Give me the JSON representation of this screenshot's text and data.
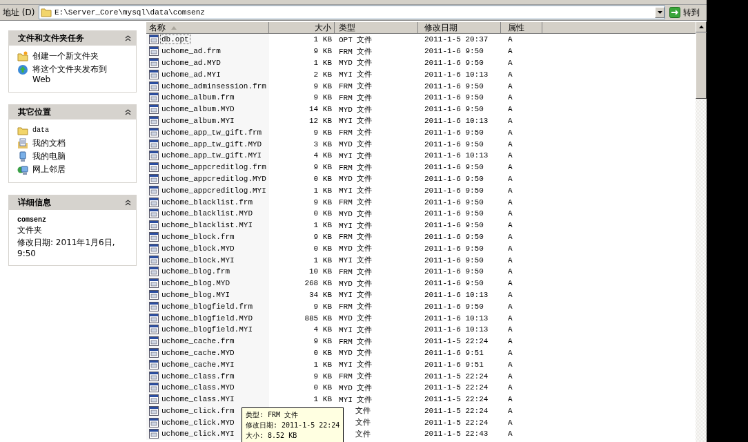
{
  "address_bar": {
    "label": "地址 (D)",
    "path": "E:\\Server_Core\\mysql\\data\\comsenz",
    "go_button": "转到"
  },
  "task_panels": [
    {
      "title": "文件和文件夹任务",
      "items": [
        {
          "label": "创建一个新文件夹",
          "kind": "new-folder"
        },
        {
          "label": "将这个文件夹发布到 Web",
          "kind": "publish-web"
        }
      ]
    },
    {
      "title": "其它位置",
      "items": [
        {
          "label": "data",
          "kind": "folder"
        },
        {
          "label": "我的文档",
          "kind": "documents"
        },
        {
          "label": "我的电脑",
          "kind": "computer"
        },
        {
          "label": "网上邻居",
          "kind": "network"
        }
      ]
    }
  ],
  "details_panel": {
    "title": "详细信息",
    "name": "comsenz",
    "type": "文件夹",
    "modified": "修改日期: 2011年1月6日, 9:50"
  },
  "columns": [
    {
      "label": "名称",
      "sorted": true
    },
    {
      "label": "大小",
      "sorted": false
    },
    {
      "label": "类型",
      "sorted": false
    },
    {
      "label": "修改日期",
      "sorted": false
    },
    {
      "label": "属性",
      "sorted": false
    }
  ],
  "rows": [
    {
      "name": "db.opt",
      "size": "1 KB",
      "type": "OPT 文件",
      "modified": "2011-1-5 20:37",
      "attr": "A",
      "focused": true
    },
    {
      "name": "uchome_ad.frm",
      "size": "9 KB",
      "type": "FRM 文件",
      "modified": "2011-1-6 9:50",
      "attr": "A",
      "focused": false
    },
    {
      "name": "uchome_ad.MYD",
      "size": "1 KB",
      "type": "MYD 文件",
      "modified": "2011-1-6 9:50",
      "attr": "A",
      "focused": false
    },
    {
      "name": "uchome_ad.MYI",
      "size": "2 KB",
      "type": "MYI 文件",
      "modified": "2011-1-6 10:13",
      "attr": "A",
      "focused": false
    },
    {
      "name": "uchome_adminsession.frm",
      "size": "9 KB",
      "type": "FRM 文件",
      "modified": "2011-1-6 9:50",
      "attr": "A",
      "focused": false
    },
    {
      "name": "uchome_album.frm",
      "size": "9 KB",
      "type": "FRM 文件",
      "modified": "2011-1-6 9:50",
      "attr": "A",
      "focused": false
    },
    {
      "name": "uchome_album.MYD",
      "size": "14 KB",
      "type": "MYD 文件",
      "modified": "2011-1-6 9:50",
      "attr": "A",
      "focused": false
    },
    {
      "name": "uchome_album.MYI",
      "size": "12 KB",
      "type": "MYI 文件",
      "modified": "2011-1-6 10:13",
      "attr": "A",
      "focused": false
    },
    {
      "name": "uchome_app_tw_gift.frm",
      "size": "9 KB",
      "type": "FRM 文件",
      "modified": "2011-1-6 9:50",
      "attr": "A",
      "focused": false
    },
    {
      "name": "uchome_app_tw_gift.MYD",
      "size": "3 KB",
      "type": "MYD 文件",
      "modified": "2011-1-6 9:50",
      "attr": "A",
      "focused": false
    },
    {
      "name": "uchome_app_tw_gift.MYI",
      "size": "4 KB",
      "type": "MYI 文件",
      "modified": "2011-1-6 10:13",
      "attr": "A",
      "focused": false
    },
    {
      "name": "uchome_appcreditlog.frm",
      "size": "9 KB",
      "type": "FRM 文件",
      "modified": "2011-1-6 9:50",
      "attr": "A",
      "focused": false
    },
    {
      "name": "uchome_appcreditlog.MYD",
      "size": "0 KB",
      "type": "MYD 文件",
      "modified": "2011-1-6 9:50",
      "attr": "A",
      "focused": false
    },
    {
      "name": "uchome_appcreditlog.MYI",
      "size": "1 KB",
      "type": "MYI 文件",
      "modified": "2011-1-6 9:50",
      "attr": "A",
      "focused": false
    },
    {
      "name": "uchome_blacklist.frm",
      "size": "9 KB",
      "type": "FRM 文件",
      "modified": "2011-1-6 9:50",
      "attr": "A",
      "focused": false
    },
    {
      "name": "uchome_blacklist.MYD",
      "size": "0 KB",
      "type": "MYD 文件",
      "modified": "2011-1-6 9:50",
      "attr": "A",
      "focused": false
    },
    {
      "name": "uchome_blacklist.MYI",
      "size": "1 KB",
      "type": "MYI 文件",
      "modified": "2011-1-6 9:50",
      "attr": "A",
      "focused": false
    },
    {
      "name": "uchome_block.frm",
      "size": "9 KB",
      "type": "FRM 文件",
      "modified": "2011-1-6 9:50",
      "attr": "A",
      "focused": false
    },
    {
      "name": "uchome_block.MYD",
      "size": "0 KB",
      "type": "MYD 文件",
      "modified": "2011-1-6 9:50",
      "attr": "A",
      "focused": false
    },
    {
      "name": "uchome_block.MYI",
      "size": "1 KB",
      "type": "MYI 文件",
      "modified": "2011-1-6 9:50",
      "attr": "A",
      "focused": false
    },
    {
      "name": "uchome_blog.frm",
      "size": "10 KB",
      "type": "FRM 文件",
      "modified": "2011-1-6 9:50",
      "attr": "A",
      "focused": false
    },
    {
      "name": "uchome_blog.MYD",
      "size": "268 KB",
      "type": "MYD 文件",
      "modified": "2011-1-6 9:50",
      "attr": "A",
      "focused": false
    },
    {
      "name": "uchome_blog.MYI",
      "size": "34 KB",
      "type": "MYI 文件",
      "modified": "2011-1-6 10:13",
      "attr": "A",
      "focused": false
    },
    {
      "name": "uchome_blogfield.frm",
      "size": "9 KB",
      "type": "FRM 文件",
      "modified": "2011-1-6 9:50",
      "attr": "A",
      "focused": false
    },
    {
      "name": "uchome_blogfield.MYD",
      "size": "885 KB",
      "type": "MYD 文件",
      "modified": "2011-1-6 10:13",
      "attr": "A",
      "focused": false
    },
    {
      "name": "uchome_blogfield.MYI",
      "size": "4 KB",
      "type": "MYI 文件",
      "modified": "2011-1-6 10:13",
      "attr": "A",
      "focused": false
    },
    {
      "name": "uchome_cache.frm",
      "size": "9 KB",
      "type": "FRM 文件",
      "modified": "2011-1-5 22:24",
      "attr": "A",
      "focused": false
    },
    {
      "name": "uchome_cache.MYD",
      "size": "0 KB",
      "type": "MYD 文件",
      "modified": "2011-1-6 9:51",
      "attr": "A",
      "focused": false
    },
    {
      "name": "uchome_cache.MYI",
      "size": "1 KB",
      "type": "MYI 文件",
      "modified": "2011-1-6 9:51",
      "attr": "A",
      "focused": false
    },
    {
      "name": "uchome_class.frm",
      "size": "9 KB",
      "type": "FRM 文件",
      "modified": "2011-1-5 22:24",
      "attr": "A",
      "focused": false
    },
    {
      "name": "uchome_class.MYD",
      "size": "0 KB",
      "type": "MYD 文件",
      "modified": "2011-1-5 22:24",
      "attr": "A",
      "focused": false
    },
    {
      "name": "uchome_class.MYI",
      "size": "1 KB",
      "type": "MYI 文件",
      "modified": "2011-1-5 22:24",
      "attr": "A",
      "focused": false
    },
    {
      "name": "uchome_click.frm",
      "type": "文件",
      "modified": "2011-1-5 22:24",
      "attr": "A",
      "focused": false
    },
    {
      "name": "uchome_click.MYD",
      "type": "文件",
      "modified": "2011-1-5 22:24",
      "attr": "A",
      "focused": false
    },
    {
      "name": "uchome_click.MYI",
      "type": "文件",
      "modified": "2011-1-5 22:43",
      "attr": "A",
      "focused": false
    }
  ],
  "tooltip": {
    "lines": [
      "类型: FRM 文件",
      "修改日期: 2011-1-5 22:24",
      "大小: 8.52 KB"
    ]
  }
}
